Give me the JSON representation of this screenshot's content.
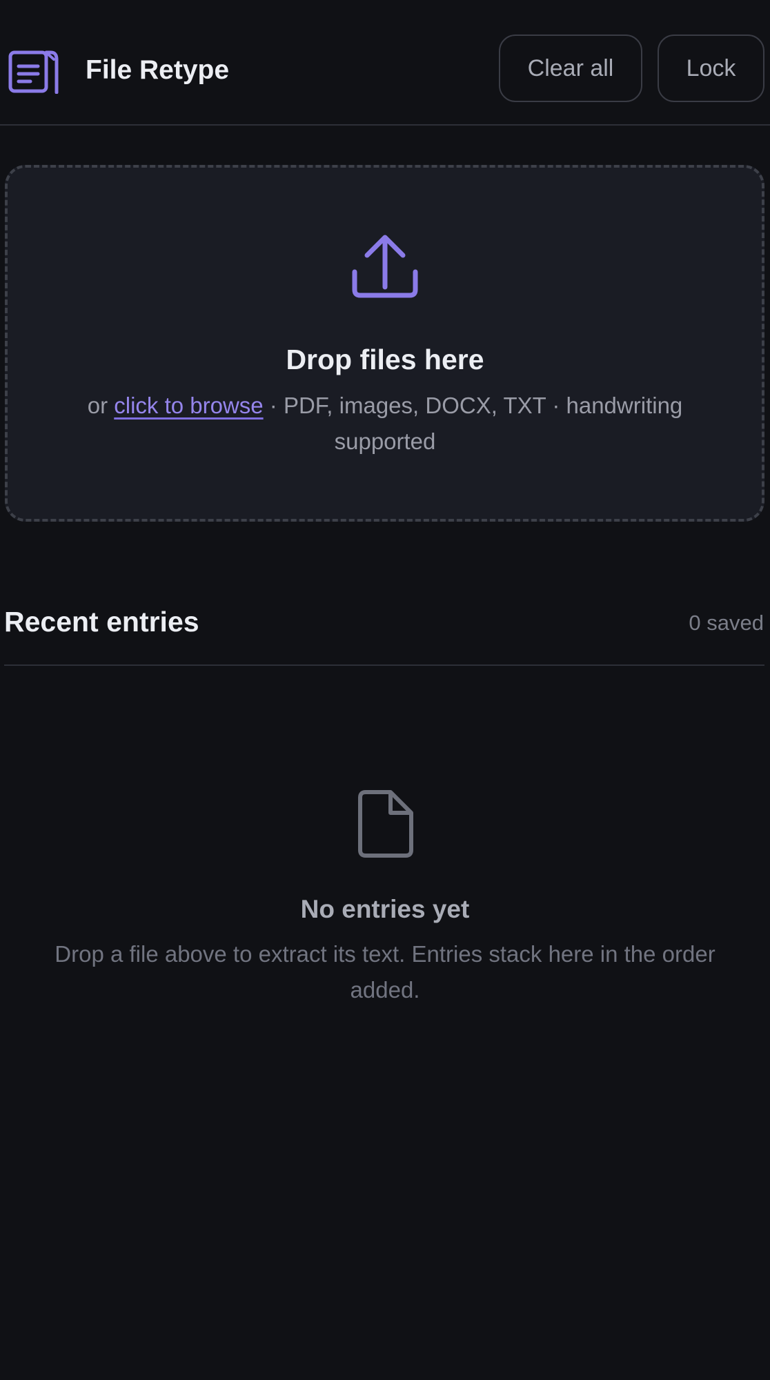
{
  "header": {
    "logo_icon": "document-icon",
    "title": "File Retype",
    "clear_all_label": "Clear all",
    "lock_label": "Lock"
  },
  "dropzone": {
    "icon": "upload-icon",
    "title": "Drop files here",
    "prefix": "or ",
    "browse_link": "click to browse",
    "suffix": " · PDF, images, DOCX, TXT · handwriting supported"
  },
  "recent": {
    "title": "Recent entries",
    "count": "0 saved",
    "empty_icon": "file-icon",
    "empty_title": "No entries yet",
    "empty_description": "Drop a file above to extract its text. Entries stack here in the order added."
  },
  "colors": {
    "background": "#101115",
    "surface": "#1a1c24",
    "accent": "#8b7be8",
    "border": "#3a3c45",
    "text_primary": "#eceef3",
    "text_muted": "#9a9ca7"
  }
}
